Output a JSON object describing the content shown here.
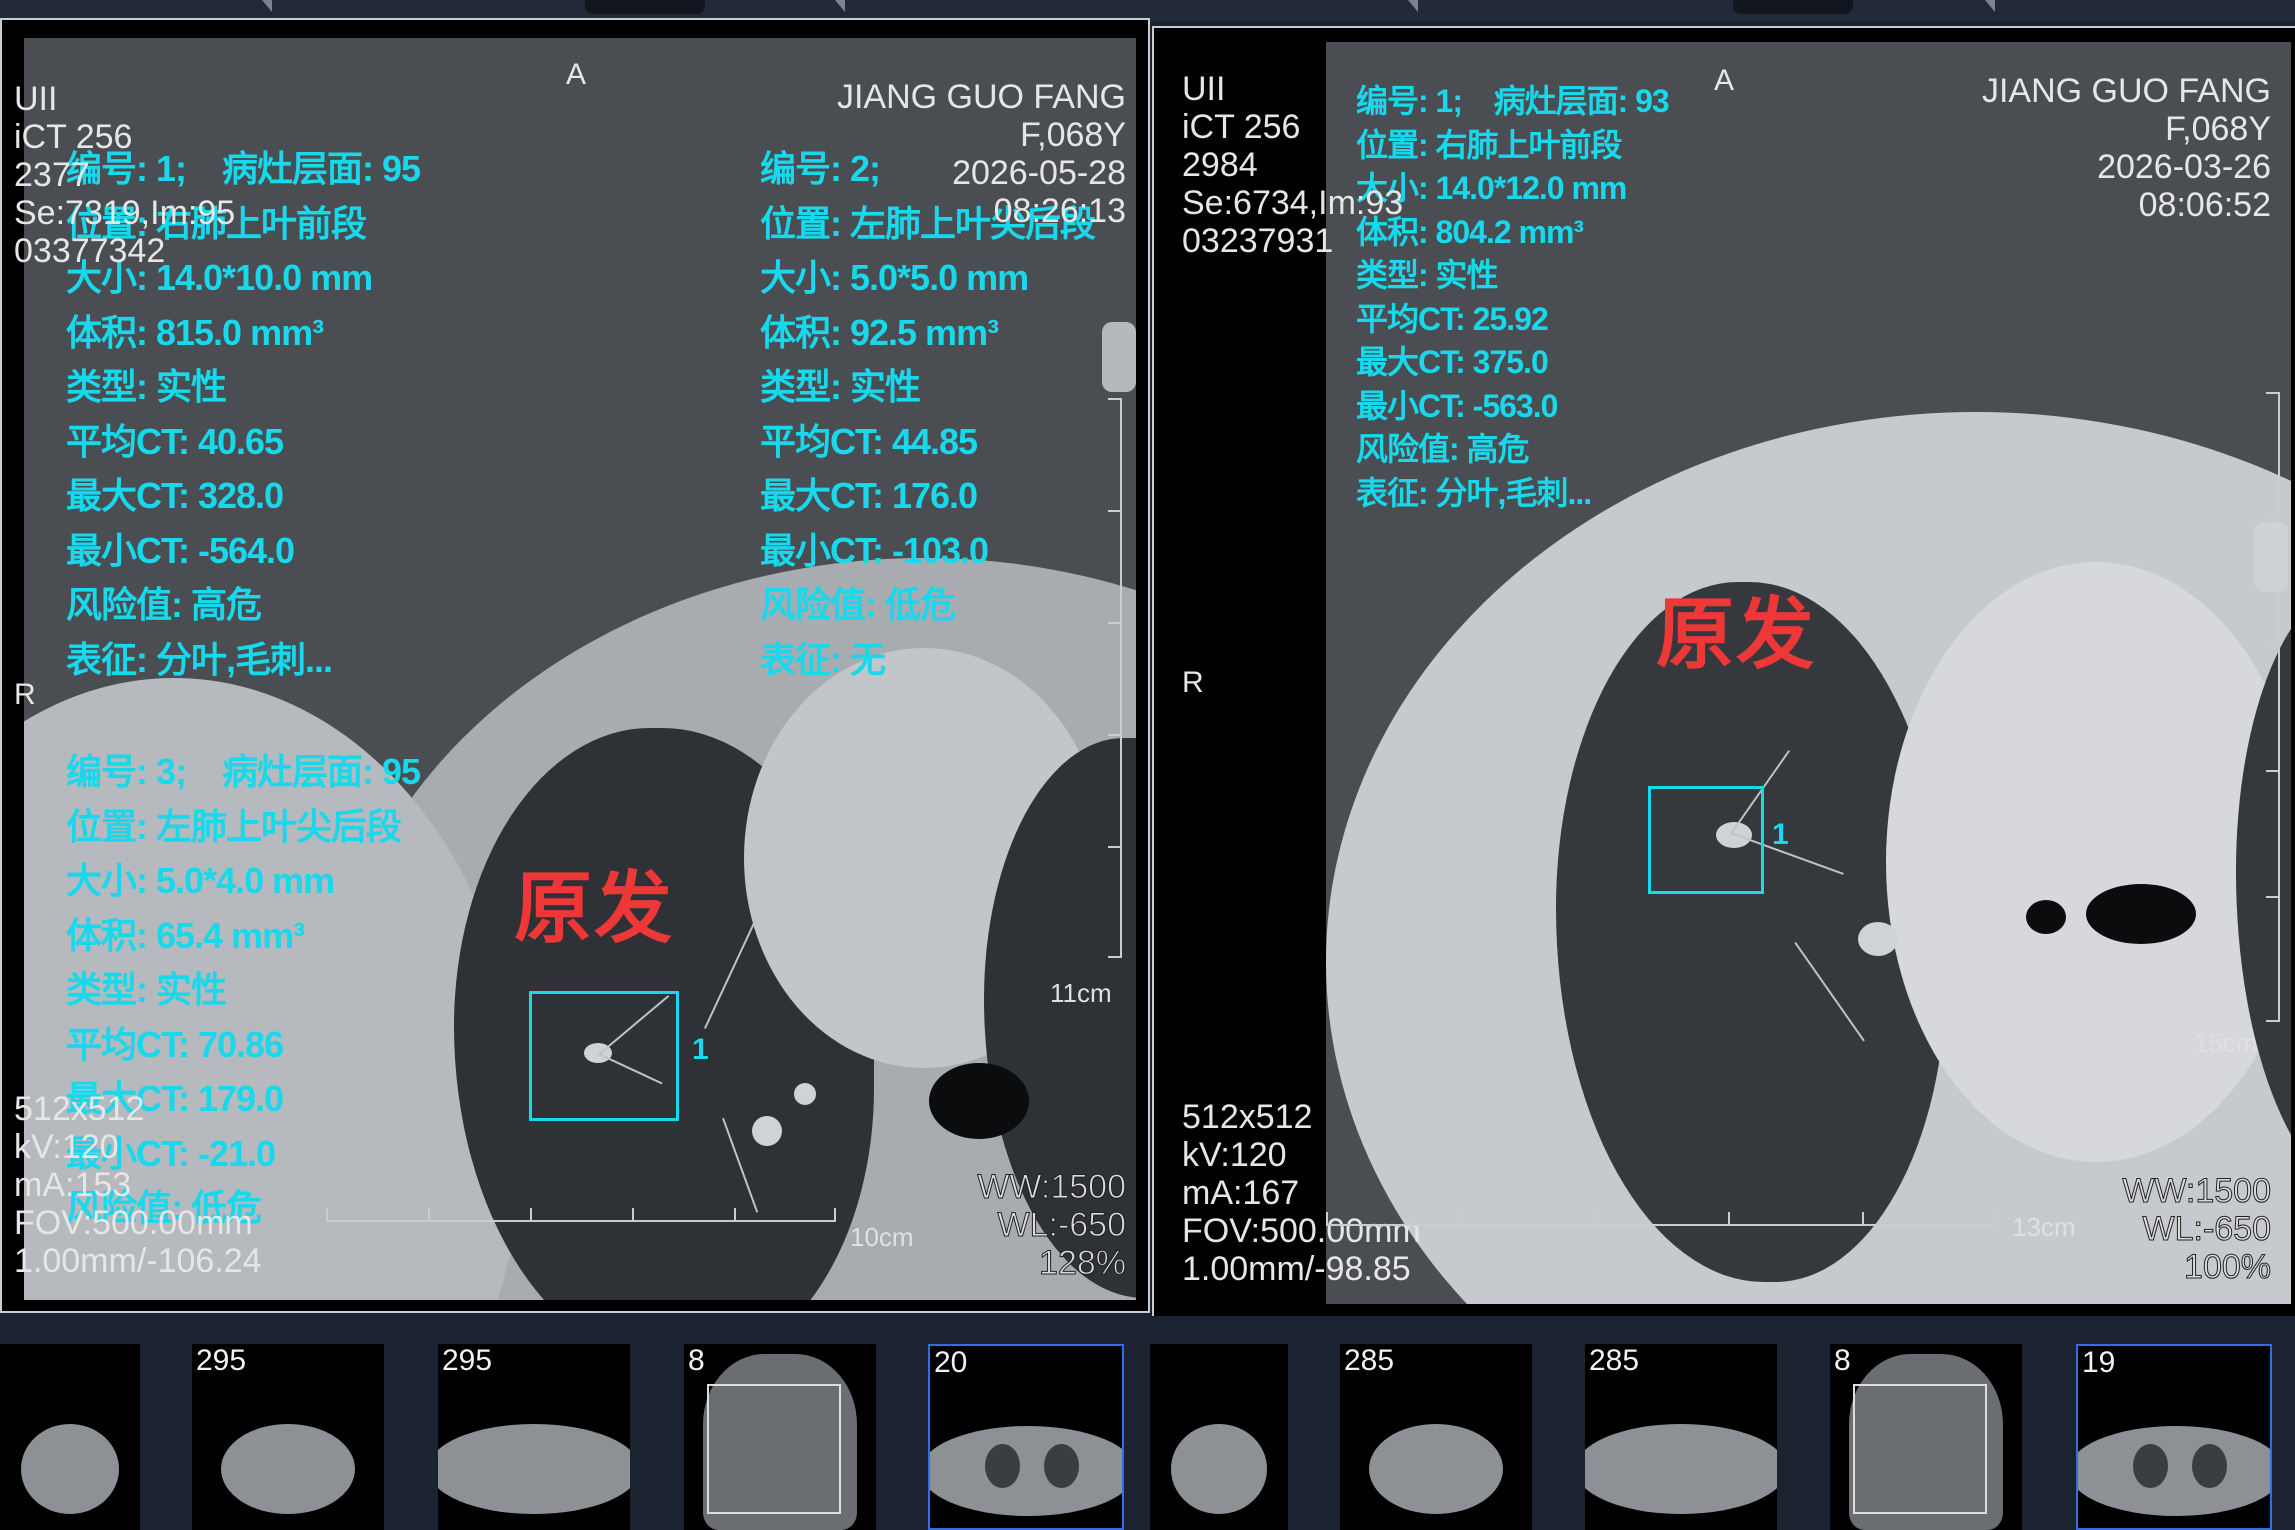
{
  "left_viewer": {
    "top_left": [
      "UII",
      "iCT 256",
      "2377",
      "Se:7319,Im:95",
      "03377342"
    ],
    "top_right": [
      "JIANG GUO FANG",
      "F,068Y",
      "2026-05-28",
      "08:26:13"
    ],
    "orient_top": "A",
    "orient_left": "R",
    "bottom_left": [
      "512x512",
      "kV:120",
      "mA:153",
      "FOV:500.00mm",
      "1.00mm/-106.24"
    ],
    "window": [
      "WW:1500",
      "WL:-650",
      "128%"
    ],
    "scale_vertical": "11cm",
    "scale_horizontal": "10cm",
    "annotation_label": "原发",
    "roi_number": "1",
    "nodule_1": [
      "编号: 1;    病灶层面: 95",
      "位置: 右肺上叶前段",
      "大小: 14.0*10.0 mm",
      "体积: 815.0 mm³",
      "类型: 实性",
      "平均CT: 40.65",
      "最大CT: 328.0",
      "最小CT: -564.0",
      "风险值: 高危",
      "表征: 分叶,毛刺..."
    ],
    "nodule_2": [
      "编号: 2;",
      "位置: 左肺上叶尖后段",
      "大小: 5.0*5.0 mm",
      "体积: 92.5 mm³",
      "类型: 实性",
      "平均CT: 44.85",
      "最大CT: 176.0",
      "最小CT: -103.0",
      "风险值: 低危",
      "表征: 无"
    ],
    "nodule_3": [
      "编号: 3;    病灶层面: 95",
      "位置: 左肺上叶尖后段",
      "大小: 5.0*4.0 mm",
      "体积: 65.4 mm³",
      "类型: 实性",
      "平均CT: 70.86",
      "最大CT: 179.0",
      "最小CT: -21.0",
      "风险值: 低危"
    ]
  },
  "right_viewer": {
    "top_left": [
      "UII",
      "iCT 256",
      "2984",
      "Se:6734,Im:93",
      "03237931"
    ],
    "top_right": [
      "JIANG GUO FANG",
      "F,068Y",
      "2026-03-26",
      "08:06:52"
    ],
    "orient_top": "A",
    "orient_left": "R",
    "bottom_left": [
      "512x512",
      "kV:120",
      "mA:167",
      "FOV:500.00mm",
      "1.00mm/-98.85"
    ],
    "window": [
      "WW:1500",
      "WL:-650",
      "100%"
    ],
    "scale_vertical": "15cm",
    "scale_horizontal": "13cm",
    "annotation_label": "原发",
    "roi_number": "1",
    "nodule_1": [
      "编号: 1;    病灶层面: 93",
      "位置: 右肺上叶前段",
      "大小: 14.0*12.0 mm",
      "体积: 804.2 mm³",
      "类型: 实性",
      "平均CT: 25.92",
      "最大CT: 375.0",
      "最小CT: -563.0",
      "风险值: 高危",
      "表征: 分叶,毛刺..."
    ]
  },
  "thumbnails": [
    {
      "label": "",
      "kind": "neck",
      "active": false
    },
    {
      "label": "295",
      "kind": "neck",
      "active": false
    },
    {
      "label": "295",
      "kind": "shoulder",
      "active": false
    },
    {
      "label": "8",
      "kind": "topogram",
      "active": false
    },
    {
      "label": "20",
      "kind": "chest",
      "active": true
    },
    {
      "label": "",
      "kind": "neck",
      "active": false
    },
    {
      "label": "285",
      "kind": "neck",
      "active": false
    },
    {
      "label": "285",
      "kind": "shoulder",
      "active": false
    },
    {
      "label": "8",
      "kind": "topogram",
      "active": false
    },
    {
      "label": "19",
      "kind": "chest",
      "active": true
    }
  ],
  "colors": {
    "annotation": "#18d8ec",
    "label_red": "#ee3737",
    "active_border": "#2f6fe3"
  }
}
